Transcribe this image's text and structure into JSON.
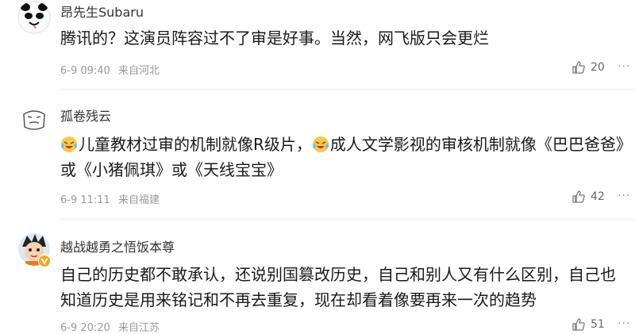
{
  "comments": [
    {
      "user": "昂先生Subaru",
      "text": "腾讯的？这演员阵容过不了审是好事。当然，网飞版只会更烂",
      "date": "6-9 09:40",
      "source": "来自河北",
      "likes": "20",
      "avatar_icon": "panda-face-icon"
    },
    {
      "user": "孤卷残云",
      "text_parts": [
        "儿童教材过审的机制就像R级片，",
        "成人文学影视的审核机制就像《巴巴爸爸》或《小猪佩琪》或《天线宝宝》"
      ],
      "date": "6-9 11:11",
      "source": "来自福建",
      "likes": "42",
      "avatar_icon": "doodle-face-icon",
      "inline_emoji": "laughing-tears-emoji-icon"
    },
    {
      "user": "越战越勇之悟饭本尊",
      "text": "自己的历史都不敢承认，还说别国篡改历史，自己和别人又有什么区别，自己也知道历史是用来铭记和不再去重复，现在却看着像要再来一次的趋势",
      "date": "6-9 20:20",
      "source": "来自江苏",
      "likes": "51",
      "avatar_icon": "cartoon-kid-icon",
      "badge": "verified-badge-icon"
    }
  ],
  "more_label": "···",
  "colors": {
    "text": "#1a1a1a",
    "meta": "#999999",
    "badge": "#f5a623"
  }
}
